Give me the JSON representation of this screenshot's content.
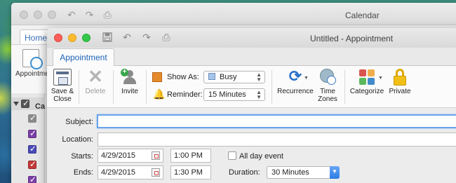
{
  "back_window": {
    "title": "Calendar",
    "tab_label": "Home",
    "appointment_label": "Appointment",
    "calendar_group_label": "Ca"
  },
  "window": {
    "title": "Untitled - Appointment",
    "tab_label": "Appointment"
  },
  "ribbon": {
    "save_close_line1": "Save &",
    "save_close_line2": "Close",
    "delete_label": "Delete",
    "invite_label": "Invite",
    "show_as_label": "Show As:",
    "show_as_value": "Busy",
    "reminder_label": "Reminder:",
    "reminder_value": "15 Minutes",
    "recurrence_label": "Recurrence",
    "time_zones_line1": "Time",
    "time_zones_line2": "Zones",
    "categorize_label": "Categorize",
    "private_label": "Private"
  },
  "form": {
    "subject_label": "Subject:",
    "subject_value": "",
    "location_label": "Location:",
    "location_value": "",
    "starts_label": "Starts:",
    "start_date": "4/29/2015",
    "start_time": "1:00 PM",
    "all_day_label": "All day event",
    "all_day_checked": false,
    "ends_label": "Ends:",
    "end_date": "4/29/2015",
    "end_time": "1:30 PM",
    "duration_label": "Duration:",
    "duration_value": "30 Minutes"
  },
  "colors": {
    "accent": "#1e63b8",
    "close": "#fc5f57",
    "minimize": "#fdbc2e",
    "maximize": "#34c84a",
    "focus_ring": "#6aa4ea",
    "busy": "#a7c4ea"
  },
  "icons": {
    "save_close": "save-close-icon",
    "delete": "delete-x-icon",
    "invite": "invite-person-icon",
    "show_as": "show-as-icon",
    "reminder": "bell-icon",
    "recurrence": "recurrence-icon",
    "time_zones": "time-zones-icon",
    "categorize": "categorize-icon",
    "private": "lock-icon"
  }
}
